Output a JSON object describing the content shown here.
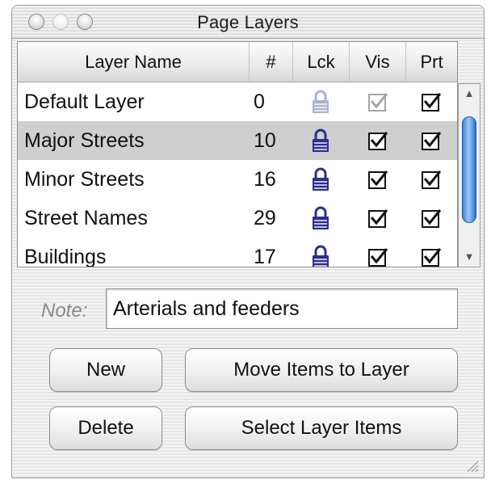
{
  "window": {
    "title": "Page Layers"
  },
  "table": {
    "headers": {
      "name": "Layer Name",
      "number": "#",
      "lock": "Lck",
      "visible": "Vis",
      "print": "Prt"
    },
    "rows": [
      {
        "name": "Default Layer",
        "number": "0",
        "locked": true,
        "visible": true,
        "print": true,
        "selected": false,
        "enabled": false
      },
      {
        "name": "Major Streets",
        "number": "10",
        "locked": true,
        "visible": true,
        "print": true,
        "selected": true,
        "enabled": true
      },
      {
        "name": "Minor Streets",
        "number": "16",
        "locked": true,
        "visible": true,
        "print": true,
        "selected": false,
        "enabled": true
      },
      {
        "name": "Street Names",
        "number": "29",
        "locked": true,
        "visible": true,
        "print": true,
        "selected": false,
        "enabled": true
      },
      {
        "name": "Buildings",
        "number": "17",
        "locked": true,
        "visible": true,
        "print": true,
        "selected": false,
        "enabled": true
      }
    ]
  },
  "note": {
    "label": "Note:",
    "value": "Arterials and feeders"
  },
  "buttons": {
    "new": "New",
    "move": "Move Items to Layer",
    "delete": "Delete",
    "select": "Select Layer Items"
  },
  "icons": {
    "lock": "padlock-icon",
    "check": "checkmark-icon",
    "scroll_up": "triangle-up-icon",
    "scroll_down": "triangle-down-icon",
    "resize": "resize-grip-icon"
  },
  "colors": {
    "selection": "#cfcfcf",
    "lock_enabled": "#2b2f8f",
    "lock_disabled": "#aeb0cf",
    "scroll_thumb": "#3f80d4"
  }
}
